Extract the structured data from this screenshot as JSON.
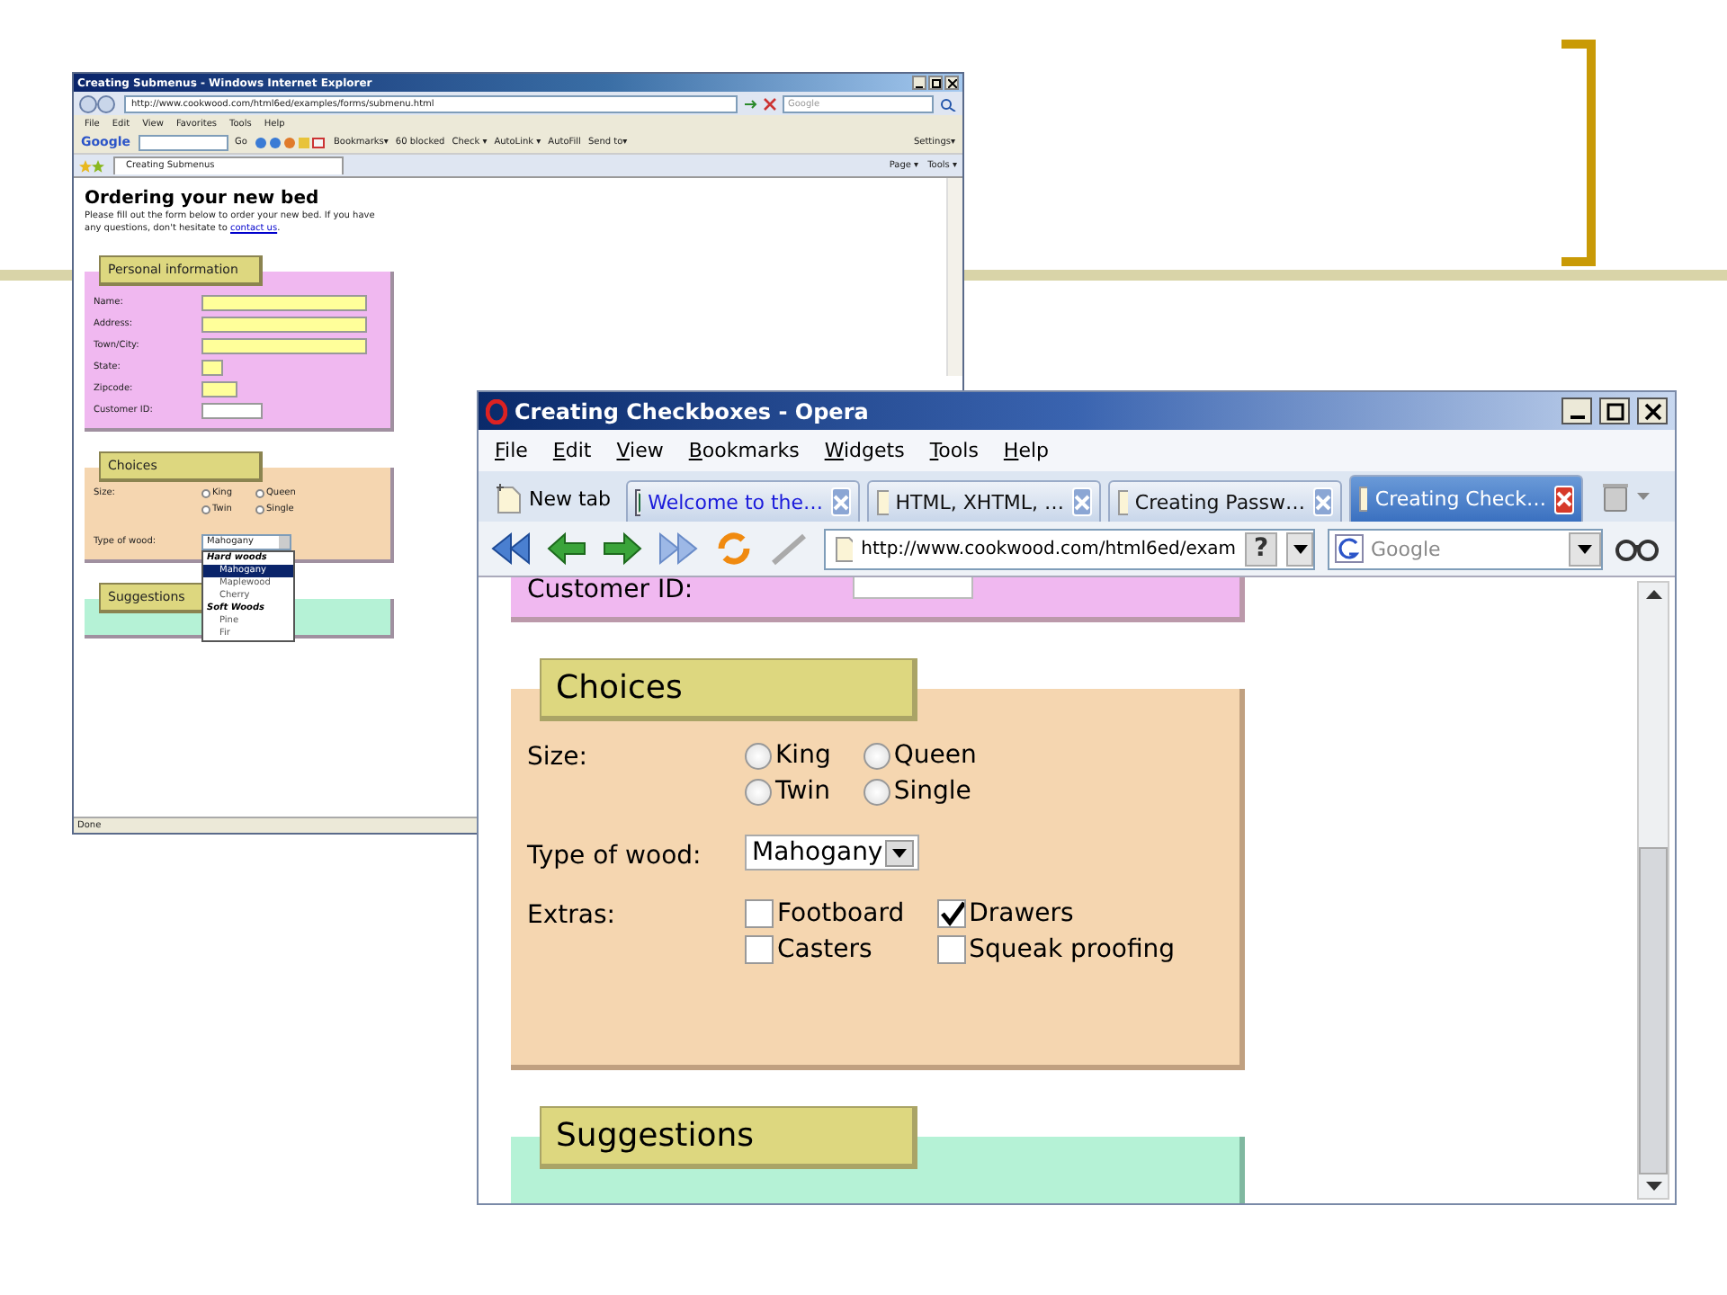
{
  "ie_window": {
    "title": "Creating Submenus - Windows Internet Explorer",
    "address": "http://www.cookwood.com/html6ed/examples/forms/submenu.html",
    "search_placeholder": "Google",
    "menu": [
      "File",
      "Edit",
      "View",
      "Favorites",
      "Tools",
      "Help"
    ],
    "google_toolbar": {
      "logo": "Google",
      "go": "Go",
      "items": [
        "Bookmarks▾",
        "60 blocked",
        "Check ▾",
        "AutoLink ▾",
        "AutoFill",
        "Send to▾"
      ],
      "settings": "Settings▾"
    },
    "tab": "Creating Submenus",
    "command_items": [
      "Page ▾",
      "Tools ▾"
    ],
    "page": {
      "heading": "Ordering your new bed",
      "intro": "Please fill out the form below to order your new bed. If you have any questions, don't hesitate to ",
      "link": "contact us",
      "intro_end": ".",
      "personal": {
        "legend": "Personal information",
        "fields": [
          {
            "label": "Name:",
            "kind": "long",
            "autofill": true
          },
          {
            "label": "Address:",
            "kind": "long",
            "autofill": true
          },
          {
            "label": "Town/City:",
            "kind": "long",
            "autofill": true
          },
          {
            "label": "State:",
            "kind": "tiny",
            "autofill": true
          },
          {
            "label": "Zipcode:",
            "kind": "short",
            "autofill": true
          },
          {
            "label": "Customer ID:",
            "kind": "medium",
            "autofill": false
          }
        ]
      },
      "choices": {
        "legend": "Choices",
        "size_label": "Size:",
        "sizes": [
          {
            "label": "King",
            "selected": false
          },
          {
            "label": "Queen",
            "selected": false
          },
          {
            "label": "Twin",
            "selected": false
          },
          {
            "label": "Single",
            "selected": false
          }
        ],
        "wood_label": "Type of wood:",
        "wood_value": "Mahogany",
        "wood_options": [
          {
            "kind": "group",
            "label": "Hard woods",
            "selected": false
          },
          {
            "kind": "option",
            "label": "Mahogany",
            "selected": true
          },
          {
            "kind": "option",
            "label": "Maplewood",
            "selected": false
          },
          {
            "kind": "option",
            "label": "Cherry",
            "selected": false
          },
          {
            "kind": "group",
            "label": "Soft Woods",
            "selected": false
          },
          {
            "kind": "option",
            "label": "Pine",
            "selected": false
          },
          {
            "kind": "option",
            "label": "Fir",
            "selected": false
          }
        ]
      },
      "suggestions": {
        "legend": "Suggestions"
      }
    },
    "status": "Done"
  },
  "opera_window": {
    "title": "Creating Checkboxes - Opera",
    "menu": [
      "File",
      "Edit",
      "View",
      "Bookmarks",
      "Widgets",
      "Tools",
      "Help"
    ],
    "new_tab": "New tab",
    "tabs": [
      {
        "label": "Welcome to the…",
        "selected": false,
        "color": "#1a1adb"
      },
      {
        "label": "HTML, XHTML, …",
        "selected": false,
        "color": "#111111"
      },
      {
        "label": "Creating Passw…",
        "selected": false,
        "color": "#111111"
      },
      {
        "label": "Creating Check…",
        "selected": true,
        "color": "#ffffff"
      }
    ],
    "address": "http://www.cookwood.com/html6ed/exam",
    "help_button": "?",
    "search_placeholder": "Google",
    "page": {
      "customer_label": "Customer ID:",
      "choices": {
        "legend": "Choices",
        "size_label": "Size:",
        "sizes": [
          {
            "label": "King",
            "selected": false
          },
          {
            "label": "Queen",
            "selected": false
          },
          {
            "label": "Twin",
            "selected": false
          },
          {
            "label": "Single",
            "selected": false
          }
        ],
        "wood_label": "Type of wood:",
        "wood_value": "Mahogany",
        "extras_label": "Extras:",
        "extras": [
          {
            "label": "Footboard",
            "checked": false
          },
          {
            "label": "Drawers",
            "checked": true
          },
          {
            "label": "Casters",
            "checked": false
          },
          {
            "label": "Squeak proofing",
            "checked": false
          }
        ]
      },
      "suggestions": {
        "legend": "Suggestions"
      }
    }
  }
}
